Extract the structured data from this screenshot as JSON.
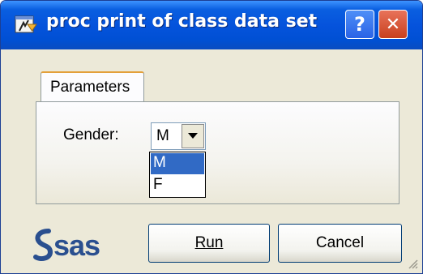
{
  "window": {
    "title": "proc print of class data set",
    "help_glyph": "?",
    "close_glyph": "✕"
  },
  "tabs": [
    {
      "label": "Parameters",
      "selected": true
    }
  ],
  "form": {
    "gender_label": "Gender:",
    "gender_value": "M",
    "gender_options": [
      "M",
      "F"
    ],
    "highlighted_option": "M"
  },
  "buttons": {
    "run_label": "Run",
    "cancel_label": "Cancel"
  },
  "logo": {
    "text": "sas",
    "color": "#2a4f8f"
  },
  "colors": {
    "titlebar": "#0553dc",
    "selection": "#316ac5",
    "close": "#c8401e",
    "tab_accent": "#e3a03a"
  },
  "icons": [
    "app-icon",
    "help-icon",
    "close-icon",
    "chevron-down-icon",
    "resize-grip-icon"
  ]
}
